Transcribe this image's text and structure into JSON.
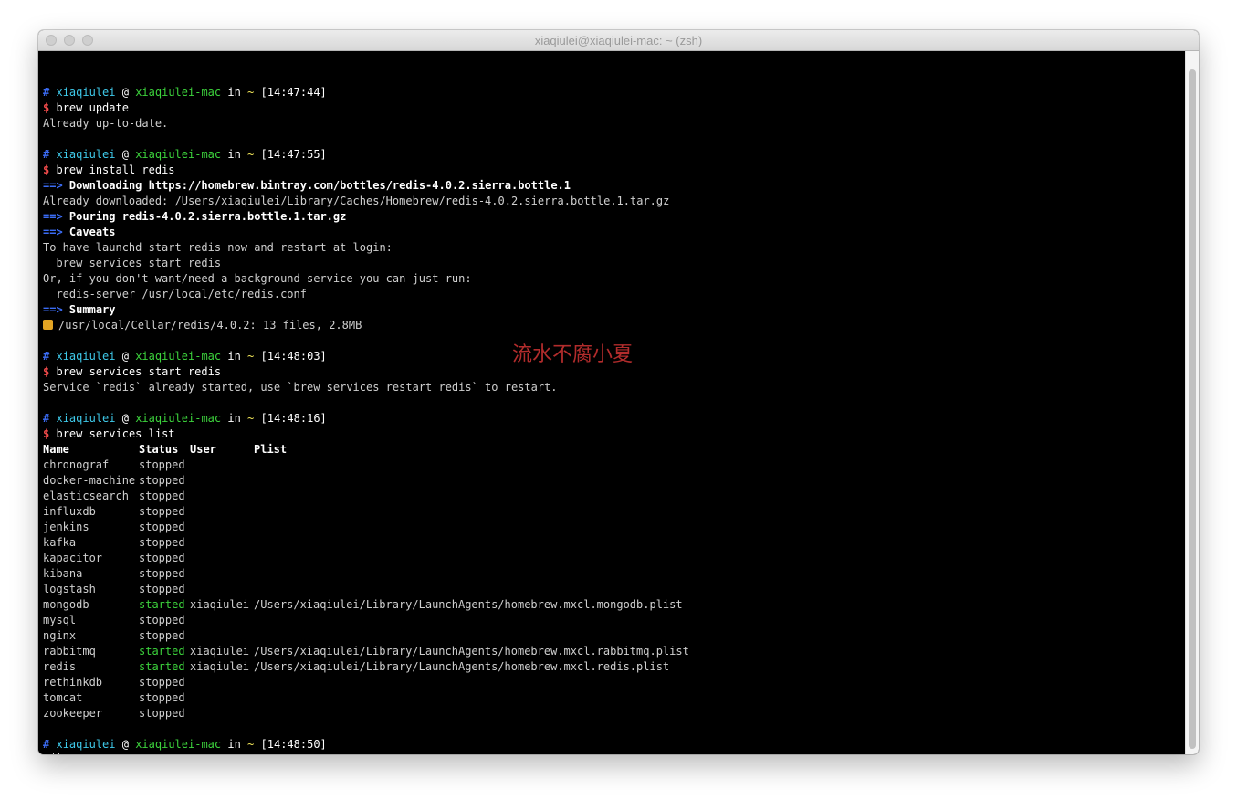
{
  "window": {
    "title": "xiaqiulei@xiaqiulei-mac: ~ (zsh)"
  },
  "watermark": "流水不腐小夏",
  "prompt": {
    "hash": "#",
    "user": "xiaqiulei",
    "at": "@",
    "host": "xiaqiulei-mac",
    "in": "in",
    "dir": "~",
    "dollar": "$"
  },
  "blocks": [
    {
      "time": "[14:47:44]",
      "command": "brew update",
      "output": [
        "Already up-to-date."
      ]
    },
    {
      "time": "[14:47:55]",
      "command": "brew install redis",
      "output": []
    },
    {
      "time": "[14:48:03]",
      "command": "brew services start redis",
      "output": [
        "Service `redis` already started, use `brew services restart redis` to restart."
      ]
    },
    {
      "time": "[14:48:16]",
      "command": "brew services list",
      "output": []
    },
    {
      "time": "[14:48:50]",
      "command": "",
      "output": []
    }
  ],
  "install": {
    "arrow": "==>",
    "downloading": "Downloading https://homebrew.bintray.com/bottles/redis-4.0.2.sierra.bottle.1",
    "already": "Already downloaded: /Users/xiaqiulei/Library/Caches/Homebrew/redis-4.0.2.sierra.bottle.1.tar.gz",
    "pouring": "Pouring redis-4.0.2.sierra.bottle.1.tar.gz",
    "caveats": "Caveats",
    "caveat_lines": [
      "To have launchd start redis now and restart at login:",
      "  brew services start redis",
      "Or, if you don't want/need a background service you can just run:",
      "  redis-server /usr/local/etc/redis.conf"
    ],
    "summary": "Summary",
    "summary_line": "/usr/local/Cellar/redis/4.0.2: 13 files, 2.8MB"
  },
  "services": {
    "headers": [
      "Name",
      "Status",
      "User",
      "Plist"
    ],
    "rows": [
      {
        "name": "chronograf",
        "status": "stopped",
        "user": "",
        "plist": ""
      },
      {
        "name": "docker-machine",
        "status": "stopped",
        "user": "",
        "plist": ""
      },
      {
        "name": "elasticsearch",
        "status": "stopped",
        "user": "",
        "plist": ""
      },
      {
        "name": "influxdb",
        "status": "stopped",
        "user": "",
        "plist": ""
      },
      {
        "name": "jenkins",
        "status": "stopped",
        "user": "",
        "plist": ""
      },
      {
        "name": "kafka",
        "status": "stopped",
        "user": "",
        "plist": ""
      },
      {
        "name": "kapacitor",
        "status": "stopped",
        "user": "",
        "plist": ""
      },
      {
        "name": "kibana",
        "status": "stopped",
        "user": "",
        "plist": ""
      },
      {
        "name": "logstash",
        "status": "stopped",
        "user": "",
        "plist": ""
      },
      {
        "name": "mongodb",
        "status": "started",
        "user": "xiaqiulei",
        "plist": "/Users/xiaqiulei/Library/LaunchAgents/homebrew.mxcl.mongodb.plist"
      },
      {
        "name": "mysql",
        "status": "stopped",
        "user": "",
        "plist": ""
      },
      {
        "name": "nginx",
        "status": "stopped",
        "user": "",
        "plist": ""
      },
      {
        "name": "rabbitmq",
        "status": "started",
        "user": "xiaqiulei",
        "plist": "/Users/xiaqiulei/Library/LaunchAgents/homebrew.mxcl.rabbitmq.plist"
      },
      {
        "name": "redis",
        "status": "started",
        "user": "xiaqiulei",
        "plist": "/Users/xiaqiulei/Library/LaunchAgents/homebrew.mxcl.redis.plist"
      },
      {
        "name": "rethinkdb",
        "status": "stopped",
        "user": "",
        "plist": ""
      },
      {
        "name": "tomcat",
        "status": "stopped",
        "user": "",
        "plist": ""
      },
      {
        "name": "zookeeper",
        "status": "stopped",
        "user": "",
        "plist": ""
      }
    ]
  },
  "colors": {
    "started": "#3cd23c",
    "user": "#3ec9e9",
    "host": "#3cd23c",
    "hash": "#3b6cf5",
    "dollar": "#ef4a4a",
    "time": "#ffffff"
  },
  "icons": {
    "summary_icon": "beer-mug-icon",
    "cursor": "terminal-cursor"
  }
}
